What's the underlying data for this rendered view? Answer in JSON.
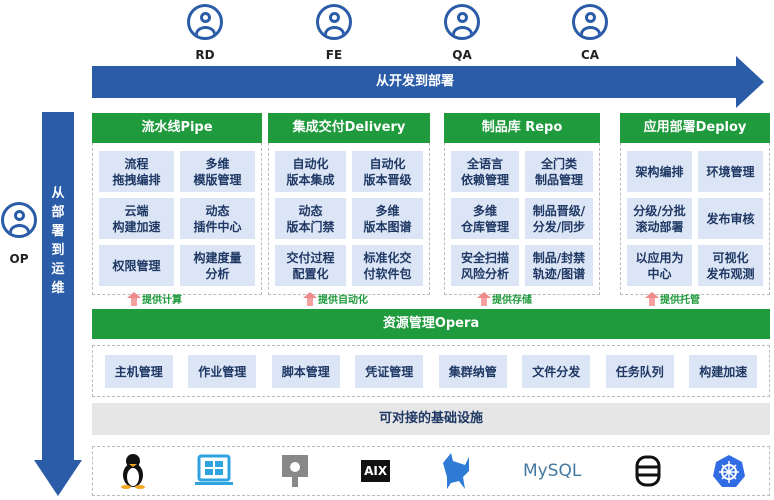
{
  "roles": [
    "RD",
    "FE",
    "QA",
    "CA"
  ],
  "op_role": "OP",
  "dev_to_deploy": "从开发到部署",
  "deploy_to_ops": "从部署到运维",
  "columns": [
    {
      "title": "流水线Pipe",
      "cells": [
        "流程\n拖拽编排",
        "多维\n模版管理",
        "云端\n构建加速",
        "动态\n插件中心",
        "权限管理",
        "构建度量\n分析"
      ],
      "provides": "提供计算"
    },
    {
      "title": "集成交付Delivery",
      "cells": [
        "自动化\n版本集成",
        "自动化\n版本晋级",
        "动态\n版本门禁",
        "多维\n版本图谱",
        "交付过程\n配置化",
        "标准化交\n付软件包"
      ],
      "provides": "提供自动化"
    },
    {
      "title": "制品库 Repo",
      "cells": [
        "全语言\n依赖管理",
        "全门类\n制品管理",
        "多维\n仓库管理",
        "制品晋级/\n分发/同步",
        "安全扫描\n风险分析",
        "制品/封禁\n轨迹/图谱"
      ],
      "provides": "提供存储"
    },
    {
      "title": "应用部署Deploy",
      "cells": [
        "架构编排",
        "环境管理",
        "分级/分批\n滚动部署",
        "发布审核",
        "以应用为\n中心",
        "可视化\n发布观测"
      ],
      "provides": "提供托管"
    }
  ],
  "resource_bar": "资源管理Opera",
  "modules": [
    "主机管理",
    "作业管理",
    "脚本管理",
    "凭证管理",
    "集群纳管",
    "文件分发",
    "任务队列",
    "构建加速"
  ],
  "infra_title": "可对接的基础设施",
  "infra_icons": [
    "linux-icon",
    "windows-icon",
    "apple-icon",
    "aix-icon",
    "kafka-icon",
    "mysql-icon",
    "database-icon",
    "kubernetes-icon"
  ],
  "mysql_logo": "MySQL",
  "aix_logo": "AIX",
  "colors": {
    "blue": "#2b5ca8",
    "green": "#1f9a3c",
    "cell": "#dbe5f5"
  }
}
